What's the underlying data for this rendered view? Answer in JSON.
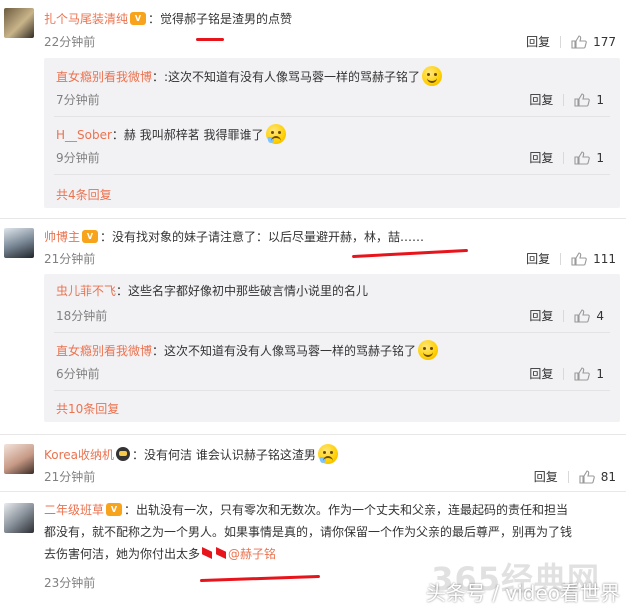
{
  "comments": [
    {
      "username": "扎个马尾装清纯",
      "text": "：觉得郝子铭是渣男的点赞",
      "time": "22分钟前",
      "reply": "回复",
      "likes": "177",
      "replies": [
        {
          "username": "直女瘾别看我微博",
          "text": "：:这次不知道有没有人像骂马蓉一样的骂赫子铭了",
          "time": "7分钟前",
          "reply": "回复",
          "likes": "1"
        },
        {
          "username": "H__Sober",
          "text": "：赫 我叫郝梓茗 我得罪谁了",
          "time": "9分钟前",
          "reply": "回复",
          "likes": "1"
        }
      ],
      "more": "共4条回复"
    },
    {
      "username": "帅博主",
      "text": "：没有找对象的妹子请注意了：以后尽量避开赫，林，喆……",
      "time": "21分钟前",
      "reply": "回复",
      "likes": "111",
      "replies": [
        {
          "username": "虫儿菲不飞",
          "text": "：这些名字都好像初中那些破言情小说里的名儿",
          "time": "18分钟前",
          "reply": "回复",
          "likes": "4"
        },
        {
          "username": "直女瘾别看我微博",
          "text": "：这次不知道有没有人像骂马蓉一样的骂赫子铭了",
          "time": "6分钟前",
          "reply": "回复",
          "likes": "1"
        }
      ],
      "more": "共10条回复"
    },
    {
      "username": "Korea收纳机",
      "text": "：没有何洁 谁会认识赫子铭这渣男",
      "time": "21分钟前",
      "reply": "回复",
      "likes": "81"
    },
    {
      "username": "二年级班草",
      "text_line1": "：出轨没有一次，只有零次和无数次。作为一个丈夫和父亲，连最起码的责任和担当",
      "text_line2": "都没有，就不配称之为一个男人。如果事情是真的，请你保留一个作为父亲的最后尊严，别再为了钱",
      "text_line3": "去伤害何洁，她为你付出太多",
      "mention": "@赫子铭",
      "time": "23分钟前"
    }
  ],
  "vip_label": "V",
  "watermark": "头条号 / video看世界",
  "watermark_365": "365经典网",
  "colors": {
    "name": "#eb7350",
    "underline": "#e8141c",
    "subbox": "#f2f2f5"
  }
}
